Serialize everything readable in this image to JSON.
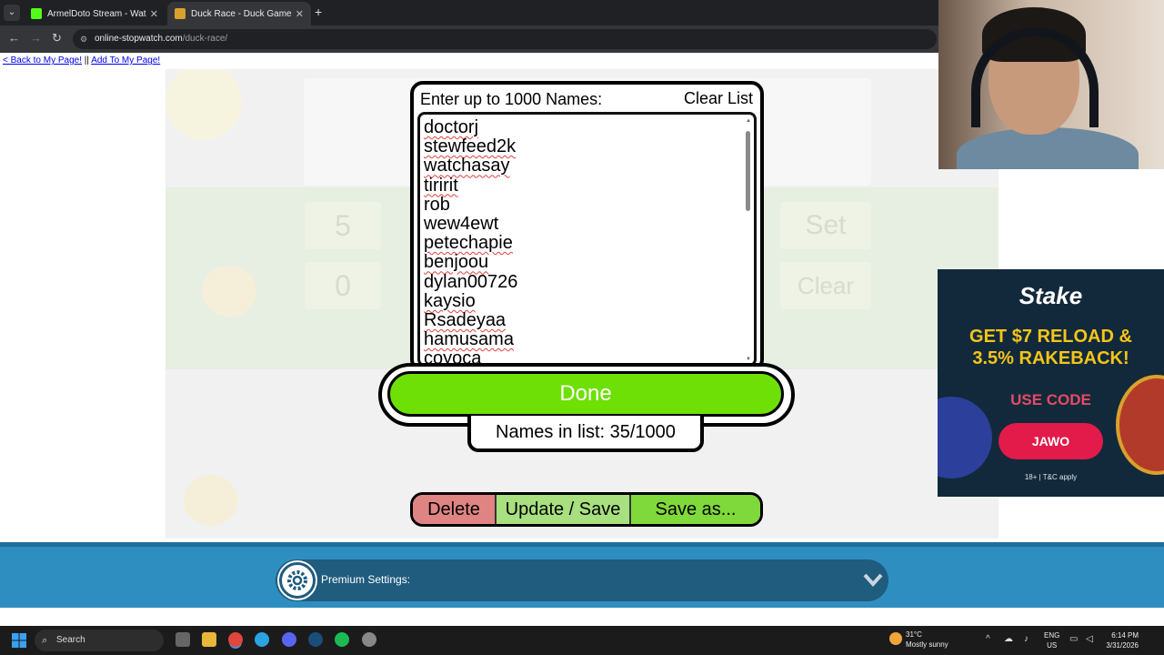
{
  "browser": {
    "tabs": [
      {
        "title": "ArmelDoto Stream - Watch Live",
        "close": "✕",
        "favicon_color": "#53fc18"
      },
      {
        "title": "Duck Race - Duck Games",
        "close": "✕",
        "favicon_color": "#d9a12c"
      }
    ],
    "new_tab": "+",
    "url_host": "online-stopwatch.com",
    "url_path": "/duck-race/"
  },
  "page": {
    "back_link": "< Back to My Page!",
    "separator": " || ",
    "add_link": "Add To My Page!"
  },
  "game_bg": {
    "cells": [
      "5",
      "0",
      "Set",
      "Clear"
    ]
  },
  "modal": {
    "heading": "Enter up to 1000 Names:",
    "clear_label": "Clear List",
    "names": [
      "doctorj",
      "stewfeed2k",
      "watchasay",
      "tiririt",
      "rob",
      "wew4ewt",
      "petechapie",
      "benjoou",
      "dylan00726",
      "kaysio",
      "Rsadeyaa",
      "hamusama",
      "coyoca"
    ],
    "done_label": "Done",
    "count_text": "Names in list: 35/1000"
  },
  "actions": {
    "delete_label": "Delete",
    "update_label": "Update / Save",
    "saveas_label": "Save as..."
  },
  "premium": {
    "label": "Premium Settings:"
  },
  "ad": {
    "brand": "Stake",
    "headline_1": "GET $7 RELOAD &",
    "headline_2": "3.5% RAKEBACK!",
    "use_code": "USE CODE",
    "code": "JAWO",
    "terms": "18+ | T&C apply"
  },
  "taskbar": {
    "search_placeholder": "Search",
    "temperature": "31°C",
    "weather": "Mostly sunny",
    "lang_1": "ENG",
    "lang_2": "US",
    "time": "6:14 PM",
    "date": "3/31/2026"
  },
  "colors": {
    "done_green": "#6ee006",
    "delete_red": "#e08483",
    "update_green": "#a8e080",
    "saveas_green": "#7fd93a",
    "premium_blue": "#2e8ec0"
  }
}
